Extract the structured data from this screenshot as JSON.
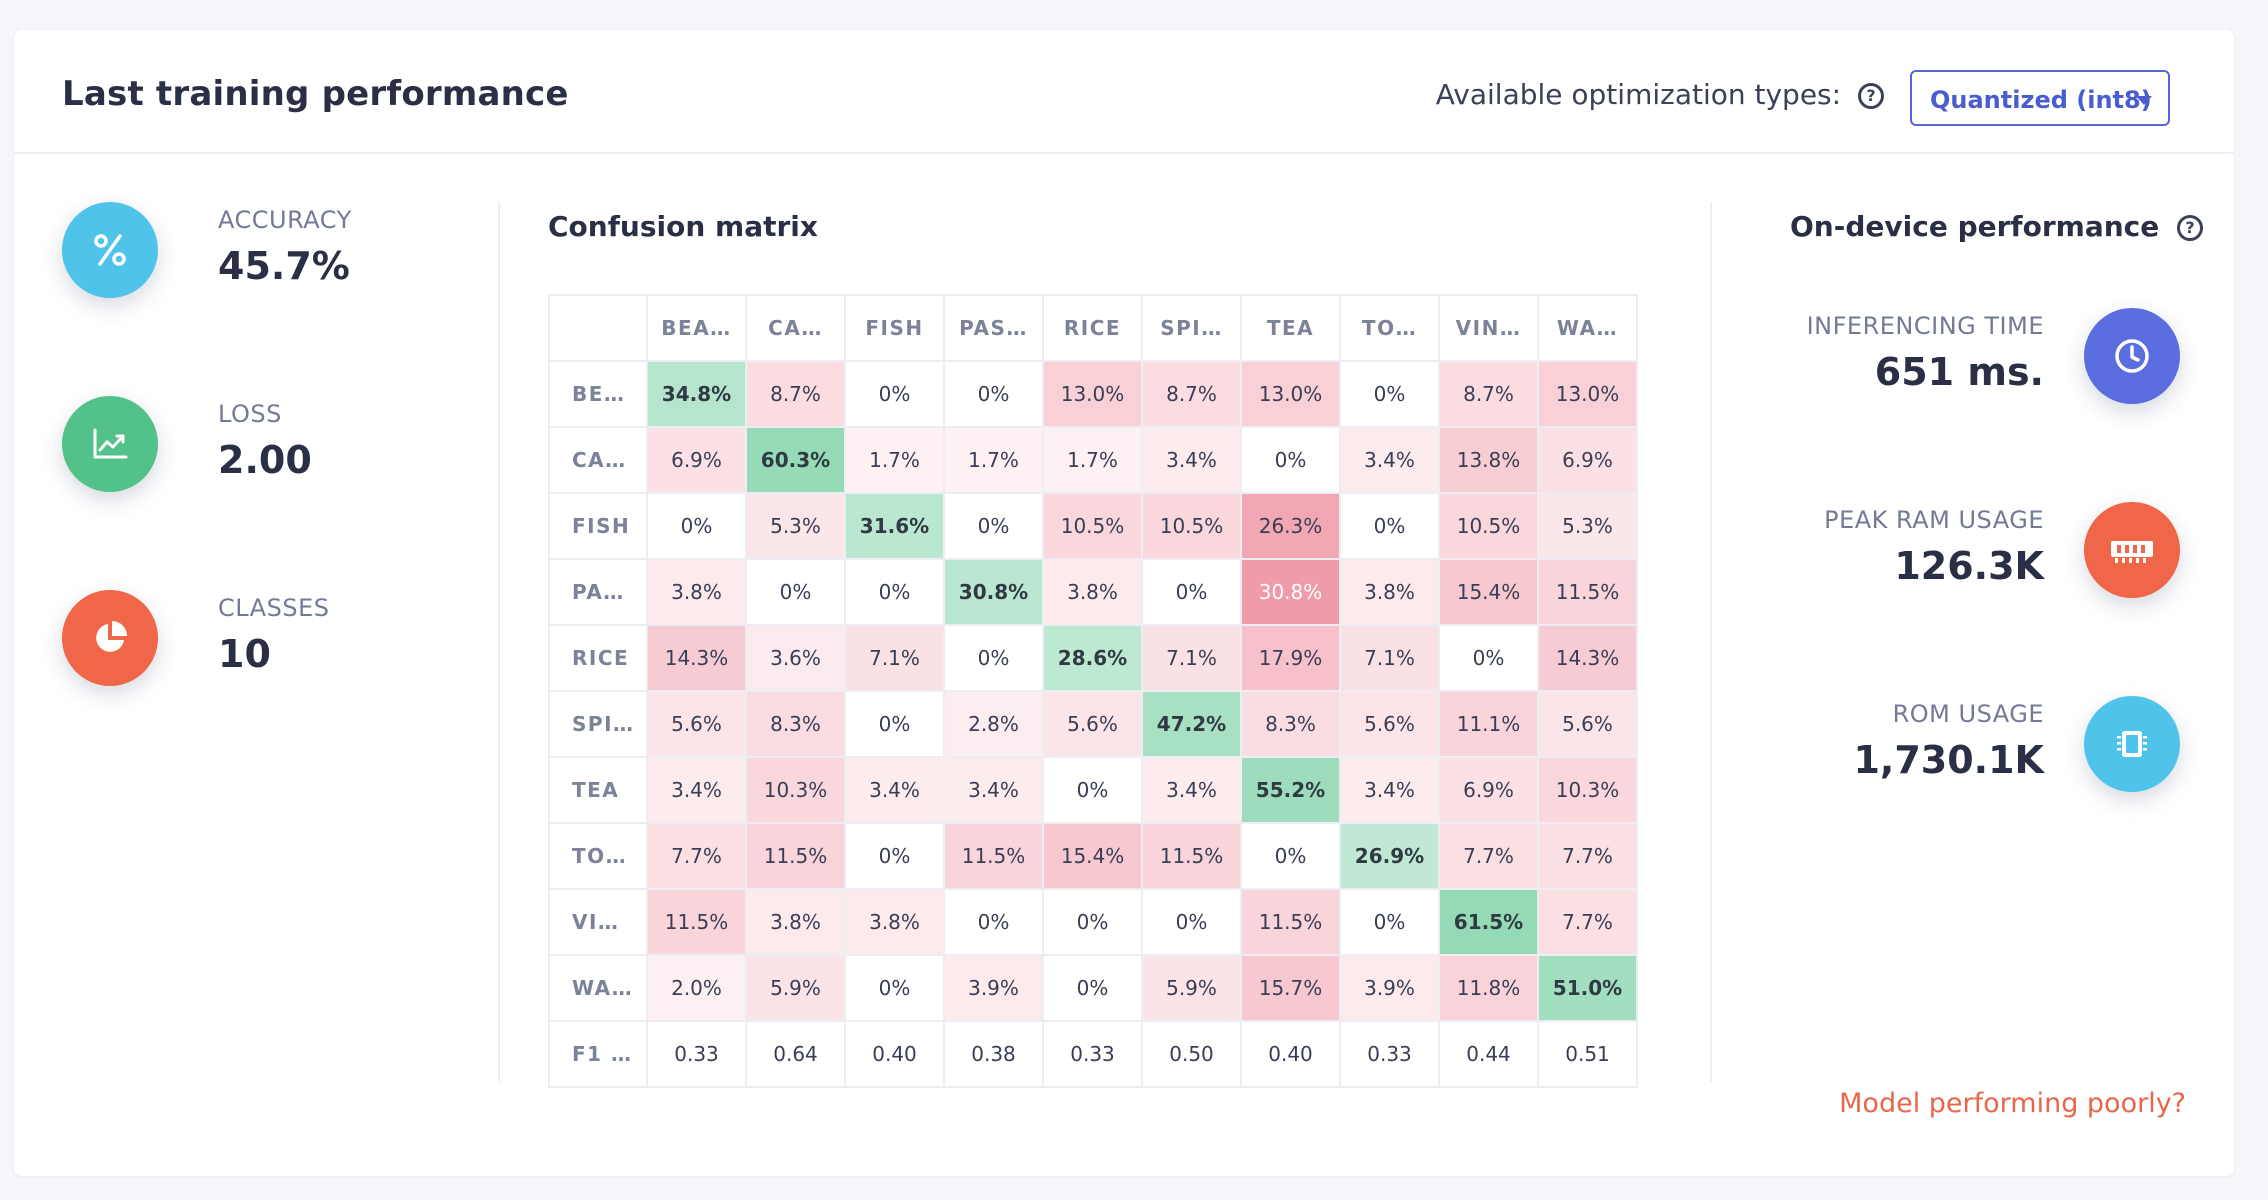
{
  "header": {
    "title": "Last training performance",
    "optimization_label": "Available optimization types:",
    "optimization_selected": "Quantized (int8)"
  },
  "metrics": [
    {
      "label": "ACCURACY",
      "value": "45.7%",
      "icon": "percent-icon",
      "color": "#4fc3ea"
    },
    {
      "label": "LOSS",
      "value": "2.00",
      "icon": "chart-line-icon",
      "color": "#52c28a"
    },
    {
      "label": "CLASSES",
      "value": "10",
      "icon": "pie-chart-icon",
      "color": "#ef6648"
    }
  ],
  "confusion_matrix": {
    "title": "Confusion matrix",
    "columns": [
      "BEA…",
      "CA…",
      "FISH",
      "PAS…",
      "RICE",
      "SPI…",
      "TEA",
      "TO…",
      "VIN…",
      "WA…"
    ],
    "rows": [
      {
        "label": "BE…",
        "cells": [
          "34.8%",
          "8.7%",
          "0%",
          "0%",
          "13.0%",
          "8.7%",
          "13.0%",
          "0%",
          "8.7%",
          "13.0%"
        ]
      },
      {
        "label": "CA…",
        "cells": [
          "6.9%",
          "60.3%",
          "1.7%",
          "1.7%",
          "1.7%",
          "3.4%",
          "0%",
          "3.4%",
          "13.8%",
          "6.9%"
        ]
      },
      {
        "label": "FISH",
        "cells": [
          "0%",
          "5.3%",
          "31.6%",
          "0%",
          "10.5%",
          "10.5%",
          "26.3%",
          "0%",
          "10.5%",
          "5.3%"
        ]
      },
      {
        "label": "PA…",
        "cells": [
          "3.8%",
          "0%",
          "0%",
          "30.8%",
          "3.8%",
          "0%",
          "30.8%",
          "3.8%",
          "15.4%",
          "11.5%"
        ]
      },
      {
        "label": "RICE",
        "cells": [
          "14.3%",
          "3.6%",
          "7.1%",
          "0%",
          "28.6%",
          "7.1%",
          "17.9%",
          "7.1%",
          "0%",
          "14.3%"
        ]
      },
      {
        "label": "SPI…",
        "cells": [
          "5.6%",
          "8.3%",
          "0%",
          "2.8%",
          "5.6%",
          "47.2%",
          "8.3%",
          "5.6%",
          "11.1%",
          "5.6%"
        ]
      },
      {
        "label": "TEA",
        "cells": [
          "3.4%",
          "10.3%",
          "3.4%",
          "3.4%",
          "0%",
          "3.4%",
          "55.2%",
          "3.4%",
          "6.9%",
          "10.3%"
        ]
      },
      {
        "label": "TO…",
        "cells": [
          "7.7%",
          "11.5%",
          "0%",
          "11.5%",
          "15.4%",
          "11.5%",
          "0%",
          "26.9%",
          "7.7%",
          "7.7%"
        ]
      },
      {
        "label": "VI…",
        "cells": [
          "11.5%",
          "3.8%",
          "3.8%",
          "0%",
          "0%",
          "0%",
          "11.5%",
          "0%",
          "61.5%",
          "7.7%"
        ]
      },
      {
        "label": "WA…",
        "cells": [
          "2.0%",
          "5.9%",
          "0%",
          "3.9%",
          "0%",
          "5.9%",
          "15.7%",
          "3.9%",
          "11.8%",
          "51.0%"
        ]
      }
    ],
    "f1_row": {
      "label": "F1 …",
      "cells": [
        "0.33",
        "0.64",
        "0.40",
        "0.38",
        "0.33",
        "0.50",
        "0.40",
        "0.33",
        "0.44",
        "0.51"
      ]
    },
    "correct_color": "#52c28a",
    "error_color": "#e8647a"
  },
  "on_device": {
    "title": "On-device performance",
    "items": [
      {
        "label": "INFERENCING TIME",
        "value": "651 ms.",
        "icon": "clock-icon",
        "color": "#5a6ee0"
      },
      {
        "label": "PEAK RAM USAGE",
        "value": "126.3K",
        "icon": "memory-icon",
        "color": "#ef6648"
      },
      {
        "label": "ROM USAGE",
        "value": "1,730.1K",
        "icon": "chip-icon",
        "color": "#4fc3ea"
      }
    ]
  },
  "footer": {
    "poor_link": "Model performing poorly?"
  }
}
